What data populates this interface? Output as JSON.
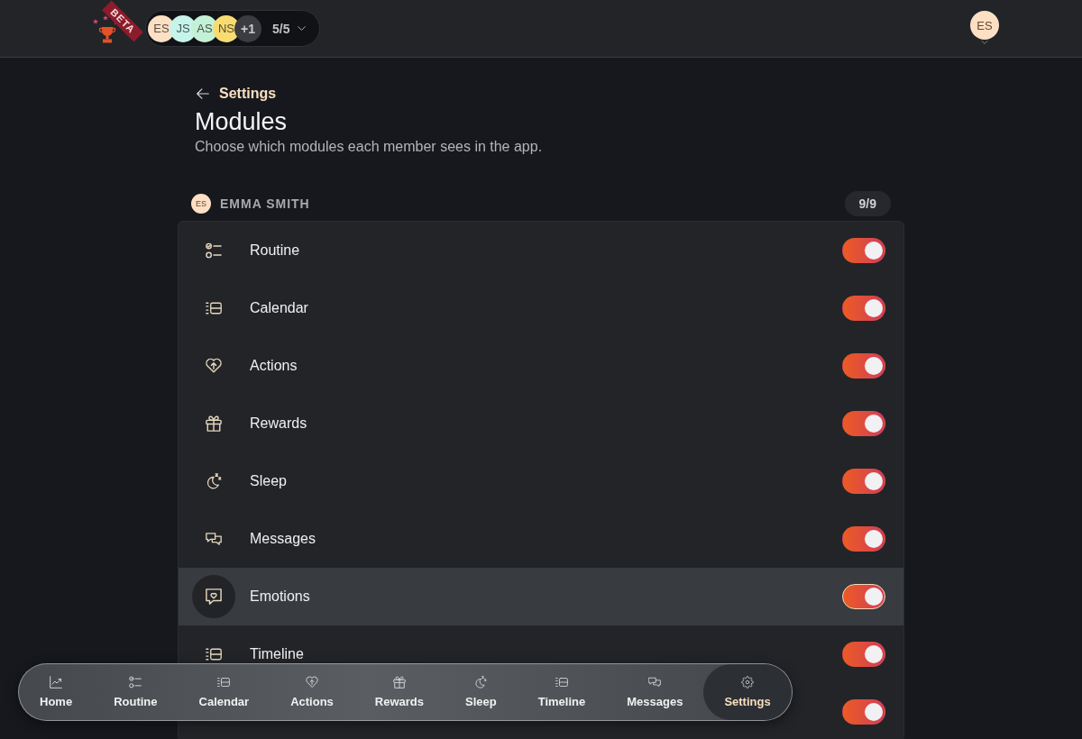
{
  "app": {
    "badge": "BETA"
  },
  "member_switcher": {
    "members": [
      {
        "initials": "ES",
        "color": "#fde0c4"
      },
      {
        "initials": "JS",
        "color": "#c6f4ea"
      },
      {
        "initials": "AS",
        "color": "#c4f1d6"
      },
      {
        "initials": "NS",
        "color": "#f8dc72"
      }
    ],
    "overflow": "+1",
    "count": "5/5"
  },
  "account": {
    "initials": "ES"
  },
  "page": {
    "back_label": "Settings",
    "title": "Modules",
    "subtitle": "Choose which modules each member sees in the app."
  },
  "member": {
    "initials": "ES",
    "name": "EMMA SMITH",
    "count": "9/9"
  },
  "modules": [
    {
      "kind": "routine",
      "label": "Routine",
      "on": true,
      "focused": false
    },
    {
      "kind": "calendar",
      "label": "Calendar",
      "on": true,
      "focused": false
    },
    {
      "kind": "actions",
      "label": "Actions",
      "on": true,
      "focused": false
    },
    {
      "kind": "rewards",
      "label": "Rewards",
      "on": true,
      "focused": false
    },
    {
      "kind": "sleep",
      "label": "Sleep",
      "on": true,
      "focused": false
    },
    {
      "kind": "messages",
      "label": "Messages",
      "on": true,
      "focused": false
    },
    {
      "kind": "emotions",
      "label": "Emotions",
      "on": true,
      "focused": true
    },
    {
      "kind": "timeline",
      "label": "Timeline",
      "on": true,
      "focused": false
    },
    {
      "on": true,
      "focused": false
    }
  ],
  "bottom_nav": [
    {
      "kind": "home",
      "label": "Home",
      "selected": false
    },
    {
      "kind": "routine",
      "label": "Routine",
      "selected": false
    },
    {
      "kind": "calendar",
      "label": "Calendar",
      "selected": false
    },
    {
      "kind": "actions",
      "label": "Actions",
      "selected": false
    },
    {
      "kind": "rewards",
      "label": "Rewards",
      "selected": false
    },
    {
      "kind": "sleep",
      "label": "Sleep",
      "selected": false
    },
    {
      "kind": "timeline",
      "label": "Timeline",
      "selected": false
    },
    {
      "kind": "messages",
      "label": "Messages",
      "selected": false
    },
    {
      "kind": "settings",
      "label": "Settings",
      "selected": true
    }
  ]
}
